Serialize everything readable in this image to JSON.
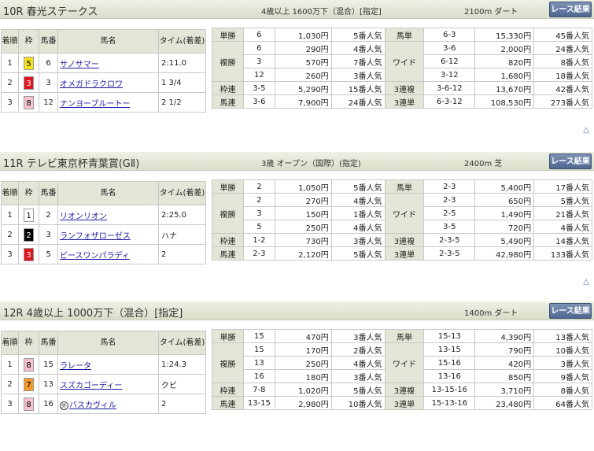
{
  "races": [
    {
      "title": "10R 春光ステークス",
      "cond": "4歳以上 1600万下（混合）[指定]",
      "dist": "2100m ダート",
      "btn": "レース結果",
      "headers": {
        "chaku": "着順",
        "waku": "枠",
        "uma": "馬番",
        "name": "馬名",
        "time": "タイム(着差)"
      },
      "results": [
        {
          "chaku": "1",
          "waku": "5",
          "uma": "6",
          "name": "サノサマー",
          "time": "2:11.0"
        },
        {
          "chaku": "2",
          "waku": "3",
          "uma": "3",
          "name": "オメガドラクロワ",
          "time": "1 3/4"
        },
        {
          "chaku": "3",
          "waku": "8",
          "uma": "12",
          "name": "ナンヨーブルートー",
          "time": "2 1/2"
        }
      ],
      "left": [
        {
          "label": "単勝",
          "rows": [
            [
              "6",
              "1,030円",
              "5番人気"
            ]
          ]
        },
        {
          "label": "複勝",
          "rows": [
            [
              "6",
              "290円",
              "4番人気"
            ],
            [
              "3",
              "570円",
              "7番人気"
            ],
            [
              "12",
              "260円",
              "3番人気"
            ]
          ]
        },
        {
          "label": "枠連",
          "rows": [
            [
              "3-5",
              "5,290円",
              "15番人気"
            ]
          ]
        },
        {
          "label": "馬連",
          "rows": [
            [
              "3-6",
              "7,900円",
              "24番人気"
            ]
          ]
        }
      ],
      "right": [
        {
          "label": "馬単",
          "rows": [
            [
              "6-3",
              "15,330円",
              "45番人気"
            ]
          ]
        },
        {
          "label": "ワイド",
          "rows": [
            [
              "3-6",
              "2,000円",
              "24番人気"
            ],
            [
              "6-12",
              "820円",
              "8番人気"
            ],
            [
              "3-12",
              "1,680円",
              "18番人気"
            ]
          ]
        },
        {
          "label": "3連複",
          "rows": [
            [
              "3-6-12",
              "13,670円",
              "42番人気"
            ]
          ]
        },
        {
          "label": "3連単",
          "rows": [
            [
              "6-3-12",
              "108,530円",
              "273番人気"
            ]
          ]
        }
      ],
      "up": "△"
    },
    {
      "title": "11R テレビ東京杯青葉賞(GⅡ)",
      "cond": "3歳 オープン（国際）(指定)",
      "dist": "2400m 芝",
      "btn": "レース結果",
      "headers": {
        "chaku": "着順",
        "waku": "枠",
        "uma": "馬番",
        "name": "馬名",
        "time": "タイム(着差)"
      },
      "results": [
        {
          "chaku": "1",
          "waku": "1",
          "uma": "2",
          "name": "リオンリオン",
          "time": "2:25.0"
        },
        {
          "chaku": "2",
          "waku": "2",
          "uma": "3",
          "name": "ランフォザローゼス",
          "time": "ハナ"
        },
        {
          "chaku": "3",
          "waku": "3",
          "uma": "5",
          "name": "ピースワンパラディ",
          "time": "2"
        }
      ],
      "left": [
        {
          "label": "単勝",
          "rows": [
            [
              "2",
              "1,050円",
              "5番人気"
            ]
          ]
        },
        {
          "label": "複勝",
          "rows": [
            [
              "2",
              "270円",
              "4番人気"
            ],
            [
              "3",
              "150円",
              "1番人気"
            ],
            [
              "5",
              "250円",
              "4番人気"
            ]
          ]
        },
        {
          "label": "枠連",
          "rows": [
            [
              "1-2",
              "730円",
              "3番人気"
            ]
          ]
        },
        {
          "label": "馬連",
          "rows": [
            [
              "2-3",
              "2,120円",
              "5番人気"
            ]
          ]
        }
      ],
      "right": [
        {
          "label": "馬単",
          "rows": [
            [
              "2-3",
              "5,400円",
              "17番人気"
            ]
          ]
        },
        {
          "label": "ワイド",
          "rows": [
            [
              "2-3",
              "650円",
              "5番人気"
            ],
            [
              "2-5",
              "1,490円",
              "21番人気"
            ],
            [
              "3-5",
              "720円",
              "4番人気"
            ]
          ]
        },
        {
          "label": "3連複",
          "rows": [
            [
              "2-3-5",
              "5,490円",
              "14番人気"
            ]
          ]
        },
        {
          "label": "3連単",
          "rows": [
            [
              "2-3-5",
              "42,980円",
              "133番人気"
            ]
          ]
        }
      ],
      "up": "△"
    },
    {
      "title": "12R 4歳以上 1000万下（混合）[指定]",
      "cond": "",
      "dist": "1400m ダート",
      "btn": "レース結果",
      "headers": {
        "chaku": "着順",
        "waku": "枠",
        "uma": "馬番",
        "name": "馬名",
        "time": "タイム(着差)"
      },
      "results": [
        {
          "chaku": "1",
          "waku": "8",
          "uma": "15",
          "name": "ラレータ",
          "time": "1:24.3"
        },
        {
          "chaku": "2",
          "waku": "7",
          "uma": "13",
          "name": "スズカゴーディー",
          "time": "クビ"
        },
        {
          "chaku": "3",
          "waku": "8",
          "uma": "16",
          "name": "バスカヴィル",
          "time": "2",
          "mark": "外"
        }
      ],
      "left": [
        {
          "label": "単勝",
          "rows": [
            [
              "15",
              "470円",
              "3番人気"
            ]
          ]
        },
        {
          "label": "複勝",
          "rows": [
            [
              "15",
              "170円",
              "2番人気"
            ],
            [
              "13",
              "250円",
              "4番人気"
            ],
            [
              "16",
              "180円",
              "3番人気"
            ]
          ]
        },
        {
          "label": "枠連",
          "rows": [
            [
              "7-8",
              "1,020円",
              "5番人気"
            ]
          ]
        },
        {
          "label": "馬連",
          "rows": [
            [
              "13-15",
              "2,980円",
              "10番人気"
            ]
          ]
        }
      ],
      "right": [
        {
          "label": "馬単",
          "rows": [
            [
              "15-13",
              "4,390円",
              "13番人気"
            ]
          ]
        },
        {
          "label": "ワイド",
          "rows": [
            [
              "13-15",
              "790円",
              "10番人気"
            ],
            [
              "15-16",
              "420円",
              "3番人気"
            ],
            [
              "13-16",
              "850円",
              "9番人気"
            ]
          ]
        },
        {
          "label": "3連複",
          "rows": [
            [
              "13-15-16",
              "3,710円",
              "8番人気"
            ]
          ]
        },
        {
          "label": "3連単",
          "rows": [
            [
              "15-13-16",
              "23,480円",
              "64番人気"
            ]
          ]
        }
      ],
      "up": ""
    }
  ],
  "colors": {
    "waku": {
      "1": {
        "bg": "#ffffff",
        "fg": "#000000"
      },
      "2": {
        "bg": "#000000",
        "fg": "#ffffff"
      },
      "3": {
        "bg": "#e0141c",
        "fg": "#ffffff"
      },
      "5": {
        "bg": "#f5e21a",
        "fg": "#000000"
      },
      "7": {
        "bg": "#f39a2b",
        "fg": "#000000"
      },
      "8": {
        "bg": "#f7c1cf",
        "fg": "#000000"
      }
    }
  }
}
